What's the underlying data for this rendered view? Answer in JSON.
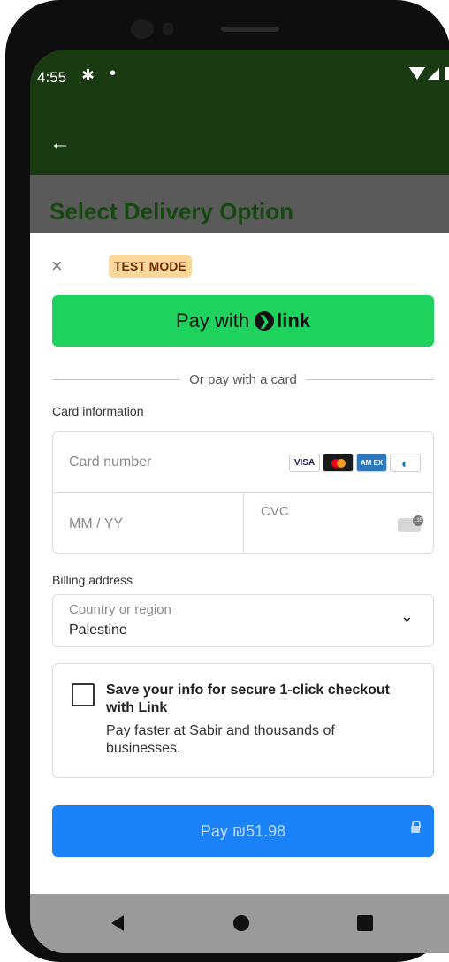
{
  "status_bar": {
    "time": "4:55",
    "gear_icon": "gear-icon",
    "notification_dot": "•"
  },
  "app_bar": {
    "back_icon": "←"
  },
  "page": {
    "title": "Select Delivery Option"
  },
  "sheet": {
    "close_icon": "×",
    "test_mode_badge": "TEST MODE",
    "link_button": {
      "prefix": "Pay with",
      "brand_chevron": "❯",
      "brand": "link"
    },
    "divider_text": "Or pay with a card",
    "card_info_label": "Card information",
    "card_number_placeholder": "Card number",
    "brands": {
      "visa": "VISA",
      "amex": "AM EX",
      "diners": "◐"
    },
    "expiry_placeholder": "MM / YY",
    "cvc_placeholder": "CVC",
    "cvc_icon_text": "135",
    "billing_label": "Billing address",
    "country_label": "Country or region",
    "country_value": "Palestine",
    "country_chevron": "⌄",
    "save_info": {
      "title": "Save your info for secure 1-click checkout with Link",
      "description": "Pay faster at Sabir and thousands of businesses."
    },
    "pay_button_label": "Pay ₪51.98"
  },
  "colors": {
    "link_green": "#1fd15d",
    "pay_blue": "#1b82f7",
    "test_badge": "#fbd89a",
    "header_green": "#1a3a12"
  }
}
